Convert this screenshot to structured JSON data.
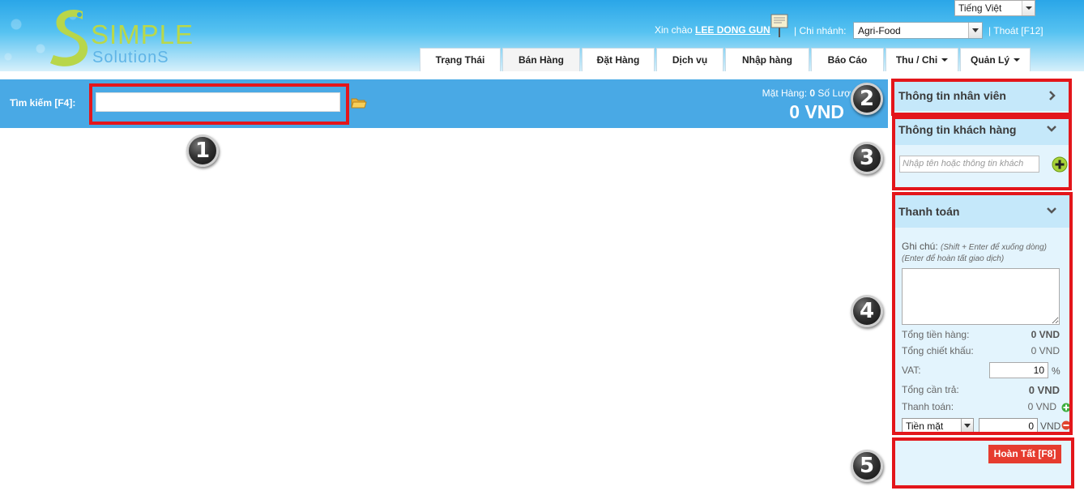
{
  "header": {
    "logo_text": "SIMPLE",
    "logo_subtext": "SolutionS",
    "language": "Tiếng Việt",
    "greeting": "Xin chào",
    "username": "LEE DONG GUN",
    "branch_label": "| Chi nhánh:",
    "branch": "Agri-Food",
    "logout": "| Thoát [F12]"
  },
  "nav": {
    "tabs": [
      {
        "label": "Trạng Thái",
        "width": 100
      },
      {
        "label": "Bán Hàng",
        "width": 96
      },
      {
        "label": "Đặt Hàng",
        "width": 90
      },
      {
        "label": "Dịch vụ",
        "width": 83
      },
      {
        "label": "Nhập hàng",
        "width": 104
      },
      {
        "label": "Báo Cáo",
        "width": 90
      },
      {
        "label": "Thu / Chi",
        "width": 90
      },
      {
        "label": "Quản Lý",
        "width": 87
      }
    ]
  },
  "search": {
    "label": "Tìm kiếm [F4]:",
    "value": "",
    "items_label": "Mặt Hàng:",
    "items_count": "0",
    "qty_label": "Số Lượ",
    "total": "0 VND"
  },
  "employee": {
    "title": "Thông tin nhân viên"
  },
  "customer": {
    "title": "Thông tin khách hàng",
    "placeholder": "Nhập tên hoặc thông tin khách"
  },
  "payment": {
    "title": "Thanh toán",
    "note_label": "Ghi chú:",
    "note_hint1": "(Shift + Enter để xuống dòng)",
    "note_hint2": "(Enter để hoàn tất giao dịch)",
    "subtotal_label": "Tổng tiền hàng:",
    "subtotal": "0 VND",
    "discount_label": "Tổng chiết khấu:",
    "discount": "0 VND",
    "vat_label": "VAT:",
    "vat_value": "10",
    "vat_unit": "%",
    "due_label": "Tổng cần trả:",
    "due": "0 VND",
    "paid_label": "Thanh toán:",
    "paid": "0 VND",
    "method": "Tiền mặt",
    "amount": "0",
    "amount_unit": "VND"
  },
  "complete_button": "Hoàn Tất [F8]",
  "annotations": [
    "1",
    "2",
    "3",
    "4",
    "5"
  ],
  "colors": {
    "header_blue": "#2aa6e8",
    "search_bar": "#49a9e5",
    "panel_bg": "#e3f4fd",
    "panel_head": "#c5e8fa",
    "complete_red": "#e63c2f",
    "annotation_red": "#e3161b"
  }
}
